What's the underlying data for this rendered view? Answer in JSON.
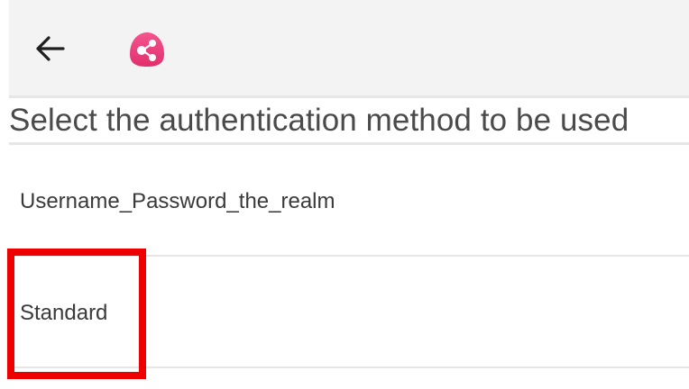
{
  "toolbar": {
    "back_icon": "arrow-left-icon",
    "logo_icon": "share-nodes-icon",
    "accent_color": "#ef3f7f"
  },
  "page": {
    "title": "Select the authentication method to be used"
  },
  "options": [
    {
      "label": "Username_Password_the_realm"
    },
    {
      "label": "Standard"
    }
  ],
  "highlight": {
    "color": "#ee0000"
  }
}
